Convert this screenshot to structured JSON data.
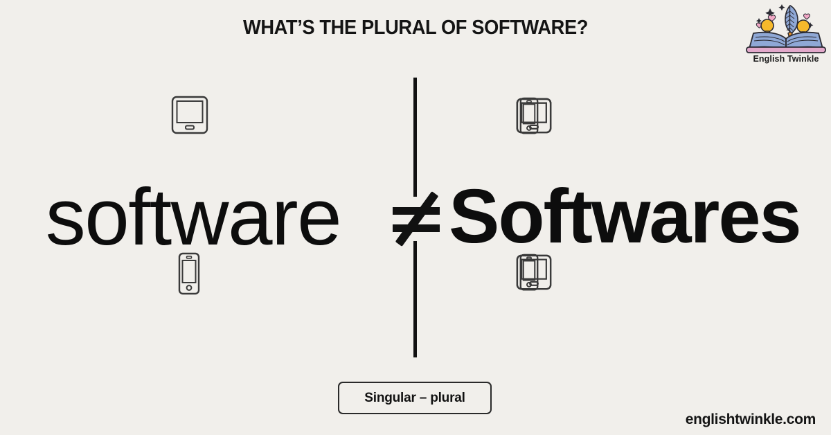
{
  "page": {
    "background_color": "#F1EFEB",
    "title": "WHAT’S THE PLURAL OF SOFTWARE?",
    "footer_url": "englishtwinkle.com"
  },
  "brand": {
    "name": "English Twinkle",
    "logo_icon": "open-book-with-quill-icon",
    "colors": {
      "book_page": "#8FA8D6",
      "book_base": "#E3A9CB",
      "bulb": "#F6B92B",
      "heart": "#F2A8C6",
      "outline": "#2B2B33"
    }
  },
  "comparison": {
    "left": {
      "word": "software",
      "form": "singular",
      "weight": "light",
      "devices_top": [
        "tablet"
      ],
      "devices_bottom": [
        "phone"
      ]
    },
    "operator": {
      "symbol": "≠",
      "icon": "not-equal-icon",
      "meaning": "not equal"
    },
    "right": {
      "word": "Softwares",
      "form": "plural",
      "weight": "bold",
      "devices_top": [
        "phone",
        "tablet",
        "tablet",
        "tablet",
        "phone"
      ],
      "devices_bottom": [
        "phone",
        "tablet",
        "phone",
        "tablet",
        "phone"
      ]
    }
  },
  "badge": {
    "label": "Singular – plural"
  }
}
